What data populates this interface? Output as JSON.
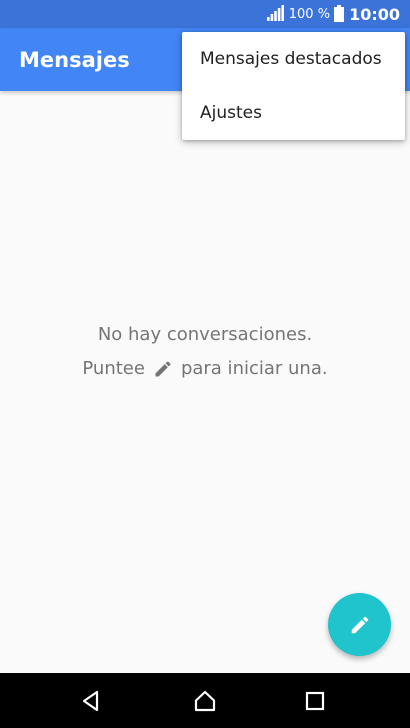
{
  "status_bar": {
    "battery_percent": "100 %",
    "time": "10:00",
    "icons": [
      "signal-icon",
      "battery-icon"
    ]
  },
  "app_bar": {
    "title": "Mensajes",
    "color": "#4285f4"
  },
  "overflow_menu": {
    "items": [
      {
        "label": "Mensajes destacados"
      },
      {
        "label": "Ajustes"
      }
    ]
  },
  "empty_state": {
    "line1": "No hay conversaciones.",
    "line2_before": "Puntee",
    "line2_icon": "pencil-icon",
    "line2_after": "para iniciar una."
  },
  "fab": {
    "icon": "pencil-icon",
    "color": "#1fc4cc"
  },
  "navigation_bar": {
    "buttons": [
      "back-icon",
      "home-icon",
      "recents-icon"
    ]
  }
}
